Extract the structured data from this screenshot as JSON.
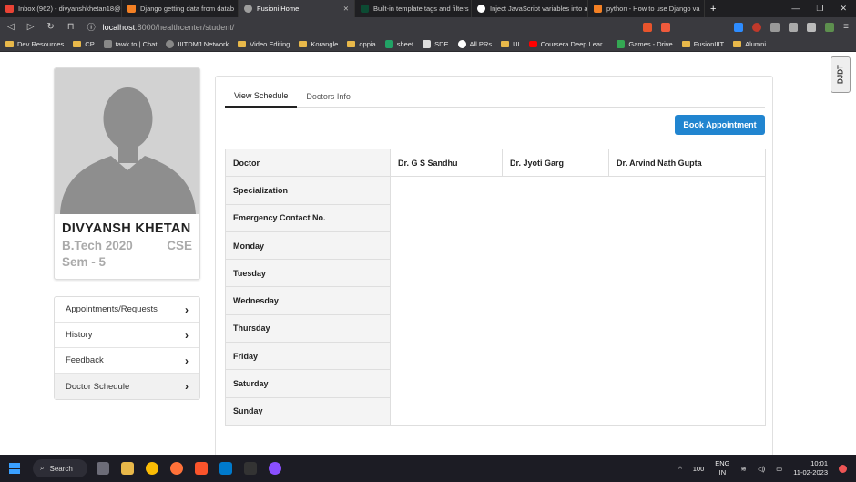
{
  "browser": {
    "tabs": [
      {
        "title": "Inbox (962) - divyanshkhetan18@",
        "icon_color": "#ea4335",
        "active": false
      },
      {
        "title": "Django getting data from datab",
        "icon_color": "#f48024",
        "active": false
      },
      {
        "title": "Fusioni Home",
        "icon_color": "#9e9e9e",
        "active": true
      },
      {
        "title": "Built-in template tags and filters",
        "icon_color": "#0c4b33",
        "active": false
      },
      {
        "title": "Inject JavaScript variables into a",
        "icon_color": "#ffffff",
        "active": false
      },
      {
        "title": "python - How to use Django va",
        "icon_color": "#f48024",
        "active": false
      }
    ],
    "new_tab_label": "+",
    "url_host": "localhost",
    "url_path": ":8000/healthcenter/student/",
    "bookmarks": [
      "Dev Resources",
      "CP",
      "tawk.to | Chat",
      "IIITDMJ Network",
      "Video Editing",
      "Korangle",
      "oppia",
      "sheet",
      "SDE",
      "All PRs",
      "UI",
      "Coursera Deep Lear...",
      "Games - Drive",
      "FusionIIIT",
      "Alumni"
    ]
  },
  "side_badge": "DJDT",
  "profile": {
    "name": "DIVYANSH KHETAN",
    "program": "B.Tech 2020",
    "branch": "CSE",
    "semester": "Sem - 5"
  },
  "menu": [
    {
      "label": "Appointments/Requests",
      "active": false
    },
    {
      "label": "History",
      "active": false
    },
    {
      "label": "Feedback",
      "active": false
    },
    {
      "label": "Doctor Schedule",
      "active": true
    }
  ],
  "tabs": [
    {
      "label": "View Schedule",
      "active": true
    },
    {
      "label": "Doctors Info",
      "active": false
    }
  ],
  "book_button": "Book Appointment",
  "schedule": {
    "row_labels": [
      "Doctor",
      "Specialization",
      "Emergency Contact No.",
      "Monday",
      "Tuesday",
      "Wednesday",
      "Thursday",
      "Friday",
      "Saturday",
      "Sunday"
    ],
    "doctors": [
      "Dr. G S Sandhu",
      "Dr. Jyoti Garg",
      "Dr. Arvind Nath Gupta"
    ]
  },
  "taskbar": {
    "search_label": "Search",
    "battery": "100",
    "lang_top": "ENG",
    "lang_bottom": "IN",
    "time": "10:01",
    "date": "11-02-2023"
  }
}
